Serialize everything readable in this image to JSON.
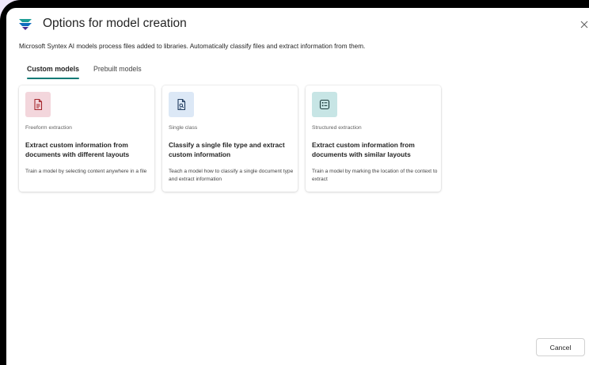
{
  "dialog": {
    "title": "Options for model creation",
    "description": "Microsoft Syntex AI models process files added to libraries. Automatically classify files and extract information from them."
  },
  "tabs": [
    {
      "label": "Custom models",
      "active": true
    },
    {
      "label": "Prebuilt models",
      "active": false
    }
  ],
  "cards": [
    {
      "kind": "Freeform extraction",
      "title": "Extract custom information from documents with different layouts",
      "description": "Train a model by selecting content anywhere in a file",
      "icon": "document-text-icon",
      "icon_bg": "#f3d6dc",
      "icon_color": "#a4262c"
    },
    {
      "kind": "Single class",
      "title": "Classify a single file type and extract custom information",
      "description": "Teach a model how to classify a single document type and extract information",
      "icon": "document-search-icon",
      "icon_bg": "#dce8f6",
      "icon_color": "#1f3b5e"
    },
    {
      "kind": "Structured extraction",
      "title": "Extract custom information from documents with similar layouts",
      "description": "Train a model by marking the location of the context to extract",
      "icon": "form-icon",
      "icon_bg": "#c7e5e5",
      "icon_color": "#1b3a3a"
    }
  ],
  "footer": {
    "cancel_label": "Cancel"
  },
  "colors": {
    "accent": "#0b7a75",
    "backdrop": "#efe7fa"
  }
}
